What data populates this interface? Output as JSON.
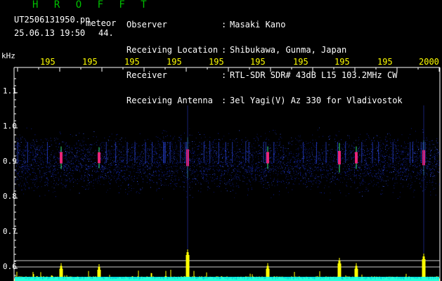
{
  "header": {
    "app_title": "H R O F F T",
    "filename": "UT2506131950.pn",
    "meteor_label": "meteor",
    "datetime": "25.06.13 19:50",
    "count": "44."
  },
  "info": {
    "rows": [
      {
        "label": "Observer",
        "value": "Masaki Kano"
      },
      {
        "label": "Receiving Location",
        "value": "Shibukawa, Gunma, Japan"
      },
      {
        "label": "Receiver",
        "value": "RTL-SDR SDR# 43dB L15 103.2MHz CW"
      },
      {
        "label": "Receiving Antenna",
        "value": "3el Yagi(V) Az 330 for Vladivostok"
      }
    ]
  },
  "axis": {
    "y_unit": "kHz",
    "y_ticks": [
      "1.1",
      "1.0",
      "0.9",
      "0.8",
      "0.7",
      "0.6"
    ],
    "x_ticks": [
      "195",
      "195",
      "195",
      "195",
      "195",
      "195",
      "195",
      "195",
      "195",
      "2000"
    ]
  },
  "colors": {
    "title": "#00c000",
    "x_ticks": "#ffff00",
    "noise_low": "#1020a0",
    "noise_high": "#4060ff",
    "echo_hot": "#ff2080",
    "echo_warm": "#40ff80",
    "histogram": "#ffff00",
    "histogram_base": "#00ffff",
    "guide_lines": "#c8c8c8"
  },
  "echoes": [
    {
      "label": "meteor-echo-1",
      "minute": 1.0,
      "strength": 0.35
    },
    {
      "label": "meteor-echo-2",
      "minute": 1.9,
      "strength": 0.3
    },
    {
      "label": "meteor-echo-3",
      "minute": 4.0,
      "strength": 1.0
    },
    {
      "label": "meteor-echo-4",
      "minute": 5.9,
      "strength": 0.35
    },
    {
      "label": "meteor-echo-5",
      "minute": 7.6,
      "strength": 0.6
    },
    {
      "label": "meteor-echo-6",
      "minute": 8.0,
      "strength": 0.35
    },
    {
      "label": "meteor-echo-7",
      "minute": 9.6,
      "strength": 0.8
    }
  ]
}
